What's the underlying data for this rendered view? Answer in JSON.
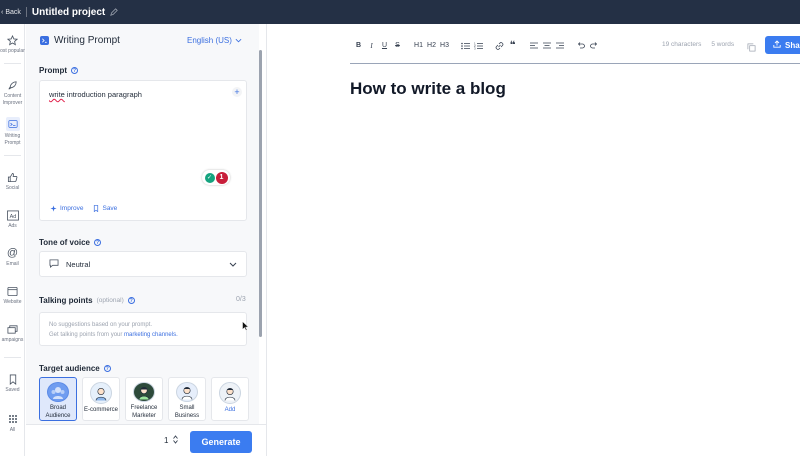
{
  "topbar": {
    "back_label": "Back",
    "project_title": "Untitled project"
  },
  "rail": {
    "items": [
      {
        "label": "ost popular",
        "icon": "star-icon"
      },
      {
        "label": "Content Improver",
        "icon": "rocket-icon"
      },
      {
        "label": "Writing Prompt",
        "icon": "terminal-icon"
      },
      {
        "label": "Social",
        "icon": "thumbs-up-icon"
      },
      {
        "label": "Ads",
        "icon": "ad-icon"
      },
      {
        "label": "Email",
        "icon": "at-icon"
      },
      {
        "label": "Website",
        "icon": "browser-icon"
      },
      {
        "label": "ampaigns",
        "icon": "layers-icon"
      },
      {
        "label": "Saved",
        "icon": "bookmark-icon"
      },
      {
        "label": "All",
        "icon": "grid-icon"
      }
    ]
  },
  "panel": {
    "title": "Writing Prompt",
    "language": "English (US)",
    "prompt": {
      "label": "Prompt",
      "text_underlined": "write",
      "text_rest": " introduction paragraph",
      "issue_count": "1",
      "improve_label": "Improve",
      "save_label": "Save"
    },
    "tone": {
      "label": "Tone of voice",
      "value": "Neutral"
    },
    "talking_points": {
      "label": "Talking points",
      "optional": "(optional)",
      "count": "0/3",
      "empty_line1": "No suggestions based on your prompt.",
      "empty_line2": "Get talking points from your ",
      "empty_link": "marketing channels."
    },
    "audience": {
      "label": "Target audience",
      "items": [
        {
          "label": "Broad Audience",
          "selected": true
        },
        {
          "label": "E-commerce",
          "selected": false
        },
        {
          "label": "Freelance Marketer",
          "selected": false
        },
        {
          "label": "Small Business",
          "selected": false
        },
        {
          "label": "Add",
          "selected": false
        }
      ]
    },
    "generate": {
      "quantity": "1",
      "button_label": "Generate"
    }
  },
  "editor": {
    "toolbar": [
      "B",
      "I",
      "U",
      "S",
      "H1",
      "H2",
      "H3"
    ],
    "characters": "19 characters",
    "words": "5 words",
    "share_label": "Share",
    "doc_title": "How to write a blog"
  },
  "colors": {
    "accent": "#3b7cf0",
    "topbar": "#243045",
    "error": "#c81e3a",
    "success": "#15a37f"
  }
}
